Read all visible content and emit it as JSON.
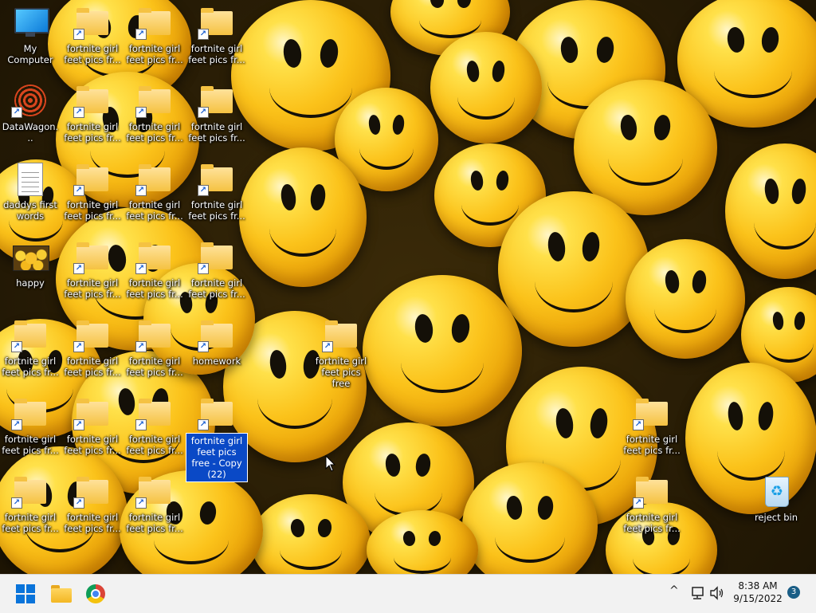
{
  "desktop": {
    "wallpaper": "yellow-smiley-balls",
    "icons": {
      "my_computer": "My Computer",
      "datawagon": "DataWagon...",
      "daddys_first_words": "daddys first words",
      "happy": "happy",
      "fortnite_trunc": "fortnite girl feet pics fr...",
      "homework": "homework",
      "fortnite_free": "fortnite girl feet pics free",
      "fortnite_copy_22": "fortnite girl feet pics free - Copy (22)",
      "reject_bin": "reject bin"
    }
  },
  "taskbar": {
    "start_icon": "windows-logo-icon",
    "explorer_icon": "file-explorer-icon",
    "chrome_icon": "chrome-icon",
    "tray": {
      "chevron": "^",
      "network_icon": "network-icon",
      "volume_icon": "volume-icon"
    },
    "clock": {
      "time": "8:38 AM",
      "date": "9/15/2022"
    },
    "notification_count": "3"
  },
  "colors": {
    "accent": "#0a74da",
    "selection": "#0a49c6",
    "taskbar_bg": "#f2f2f2"
  }
}
